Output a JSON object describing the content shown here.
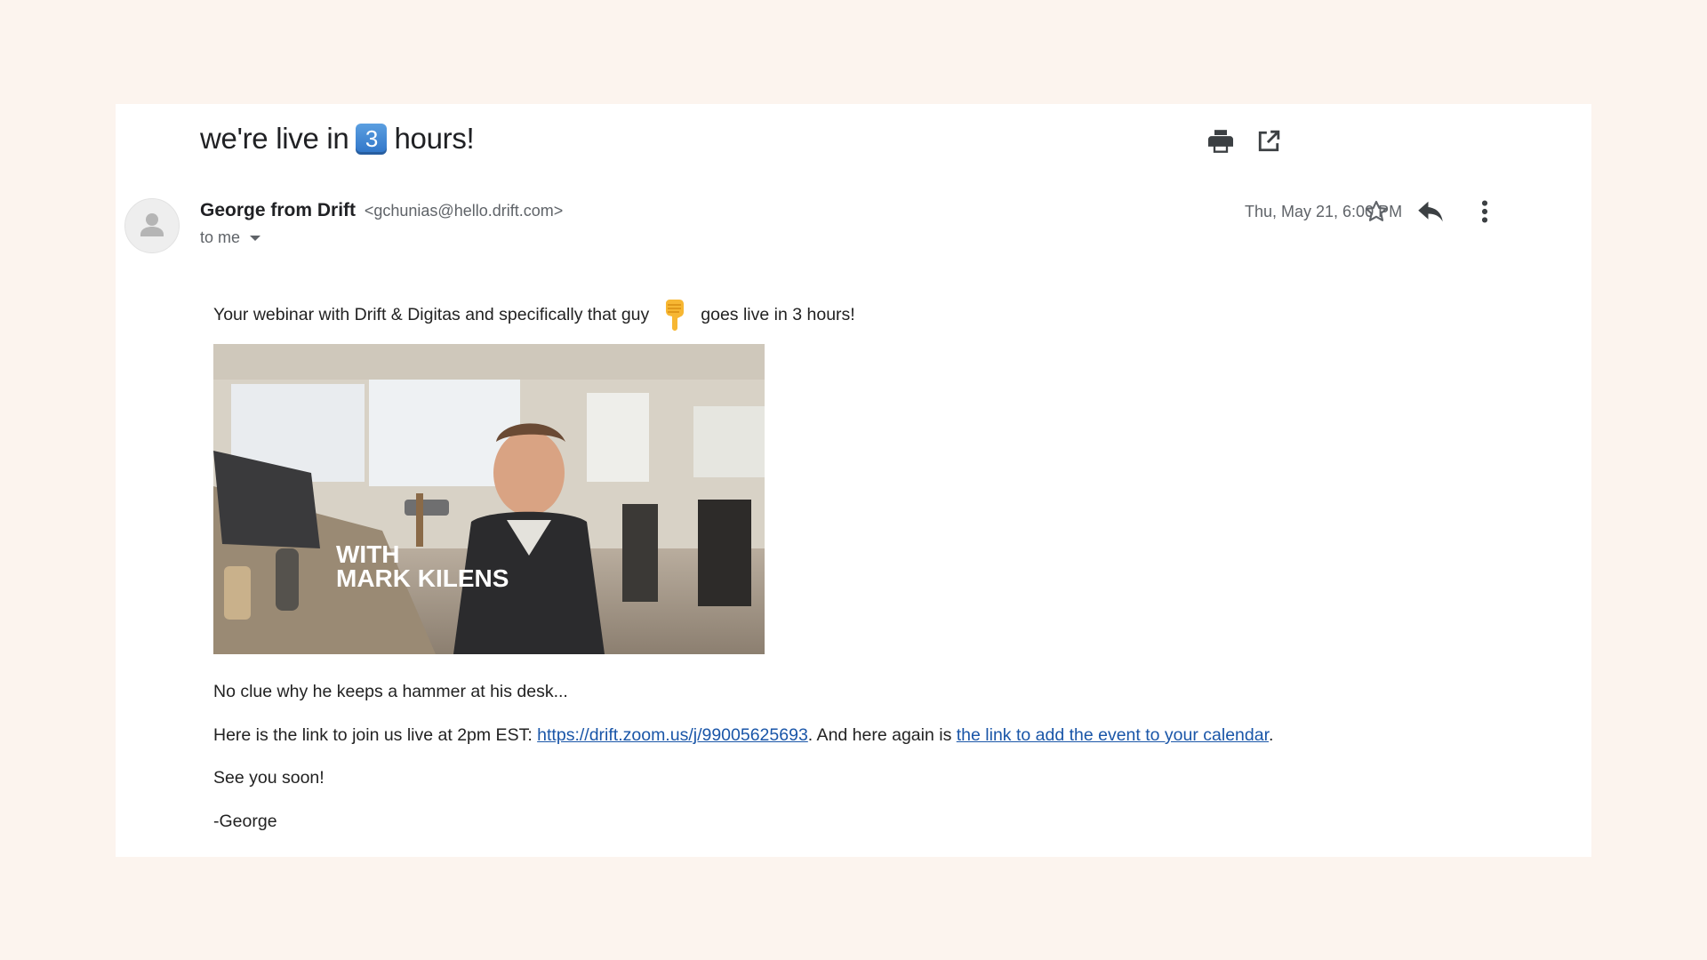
{
  "subject": {
    "before": "we're live in",
    "keycap": "3",
    "after": "hours!"
  },
  "toolbar": {
    "print_icon": "printer-icon",
    "popout_icon": "open-in-new-window-icon"
  },
  "sender": {
    "name": "George from Drift",
    "email": "<gchunias@hello.drift.com>"
  },
  "recipient": {
    "label": "to me"
  },
  "date": "Thu, May 21, 6:00 PM",
  "actions": {
    "star_icon": "star-icon",
    "reply_icon": "reply-icon",
    "more_icon": "more-vertical-icon"
  },
  "body": {
    "intro_before": "Your webinar with Drift & Digitas and specifically that guy",
    "intro_emoji": "backhand-index-pointing-down",
    "intro_after": "goes live in 3 hours!",
    "image_caption_line1": "WITH",
    "image_caption_line2": "MARK KILENS",
    "hammer_line": "No clue why he keeps a hammer at his desk...",
    "link_line_before": "Here is the link to join us live at 2pm EST: ",
    "zoom_link": "https://drift.zoom.us/j/99005625693",
    "link_line_middle": ". And here again is ",
    "calendar_link": "the link to add the event to your calendar",
    "link_line_end": ".",
    "see_you": "See you soon!",
    "signature": "-George"
  },
  "colors": {
    "page_bg": "#fcf4ee",
    "link": "#1a56a8",
    "keycap": "#3a80d0"
  }
}
